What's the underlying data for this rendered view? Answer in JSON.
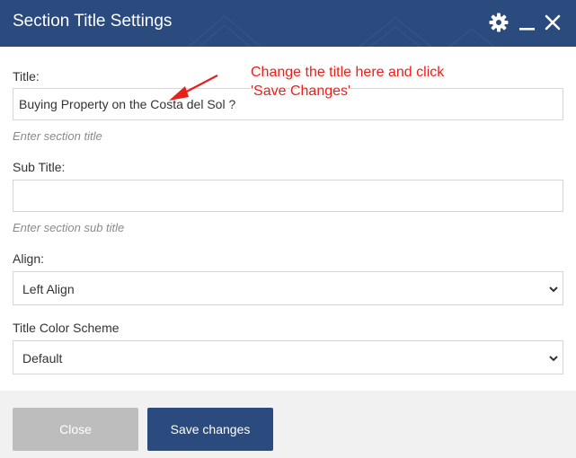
{
  "modal": {
    "title": "Section Title Settings",
    "icons": [
      "gear-icon",
      "minimize-icon",
      "close-icon"
    ],
    "header_color": "#2b4a7e"
  },
  "form": {
    "title": {
      "label": "Title:",
      "value": "Buying Property on the Costa del Sol ?",
      "help": "Enter section title"
    },
    "subtitle": {
      "label": "Sub Title:",
      "value": "",
      "help": "Enter section sub title"
    },
    "align": {
      "label": "Align:",
      "selected": "Left Align"
    },
    "color_scheme": {
      "label": "Title Color Scheme",
      "selected": "Default"
    }
  },
  "annotation": {
    "line1": "Change the title here and click",
    "line2": "'Save Changes'",
    "color": "#e8201a"
  },
  "footer": {
    "close_label": "Close",
    "save_label": "Save changes"
  }
}
